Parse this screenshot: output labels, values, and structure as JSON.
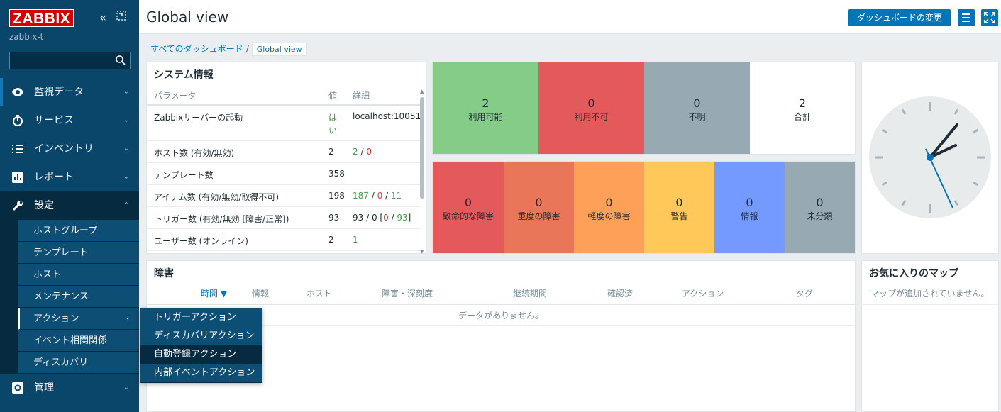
{
  "sidebar": {
    "logo": "ZABBIX",
    "host": "zabbix-t",
    "search_placeholder": "",
    "items": [
      {
        "label": "監視データ"
      },
      {
        "label": "サービス"
      },
      {
        "label": "インベントリ"
      },
      {
        "label": "レポート"
      },
      {
        "label": "設定"
      },
      {
        "label": "管理"
      }
    ],
    "submenu": [
      "ホストグループ",
      "テンプレート",
      "ホスト",
      "メンテナンス",
      "アクション",
      "イベント相関関係",
      "ディスカバリ"
    ],
    "flyout": [
      "トリガーアクション",
      "ディスカバリアクション",
      "自動登録アクション",
      "内部イベントアクション"
    ]
  },
  "header": {
    "title": "Global view",
    "edit_button": "ダッシュボードの変更"
  },
  "breadcrumb": {
    "root": "すべてのダッシュボード",
    "current": "Global view"
  },
  "system_info": {
    "title": "システム情報",
    "columns": [
      "パラメータ",
      "値",
      "詳細"
    ],
    "rows": [
      {
        "param": "Zabbixサーバーの起動",
        "value": "は い",
        "detail": "localhost:10051"
      },
      {
        "param": "ホスト数 (有効/無効)",
        "value": "2",
        "d1": "2",
        "s1": " / ",
        "d2": "0"
      },
      {
        "param": "テンプレート数",
        "value": "358"
      },
      {
        "param": "アイテム数 (有効/無効/取得不可)",
        "value": "198",
        "d1": "187",
        "s1": " / ",
        "d2": "0",
        "s2": " / ",
        "d3": "11"
      },
      {
        "param": "トリガー数 (有効/無効 [障害/正常])",
        "value": "93",
        "d0": "93 / 0 [",
        "d2": "0",
        "s2": " / ",
        "d3": "93",
        "d4": "]"
      },
      {
        "param": "ユーザー数 (オンライン)",
        "value": "2",
        "d1": "1"
      }
    ]
  },
  "host_availability": [
    {
      "count": "2",
      "label": "利用可能",
      "color": "#86cc89"
    },
    {
      "count": "0",
      "label": "利用不可",
      "color": "#e45959"
    },
    {
      "count": "0",
      "label": "不明",
      "color": "#97aab3"
    },
    {
      "count": "2",
      "label": "合計",
      "color": "#ffffff"
    }
  ],
  "severity": [
    {
      "count": "0",
      "label": "致命的な障害",
      "color": "#e45959"
    },
    {
      "count": "0",
      "label": "重度の障害",
      "color": "#e97659"
    },
    {
      "count": "0",
      "label": "軽度の障害",
      "color": "#ffa059"
    },
    {
      "count": "0",
      "label": "警告",
      "color": "#ffc859"
    },
    {
      "count": "0",
      "label": "情報",
      "color": "#7499ff"
    },
    {
      "count": "0",
      "label": "未分類",
      "color": "#97aab3"
    }
  ],
  "problems": {
    "title": "障害",
    "columns": [
      "時間 ▼",
      "情報",
      "ホスト",
      "障害・深刻度",
      "継続期間",
      "確認済",
      "アクション",
      "タグ"
    ],
    "empty": "データがありません。"
  },
  "maps": {
    "title": "お気に入りのマップ",
    "empty": "マップが追加されていません。"
  }
}
